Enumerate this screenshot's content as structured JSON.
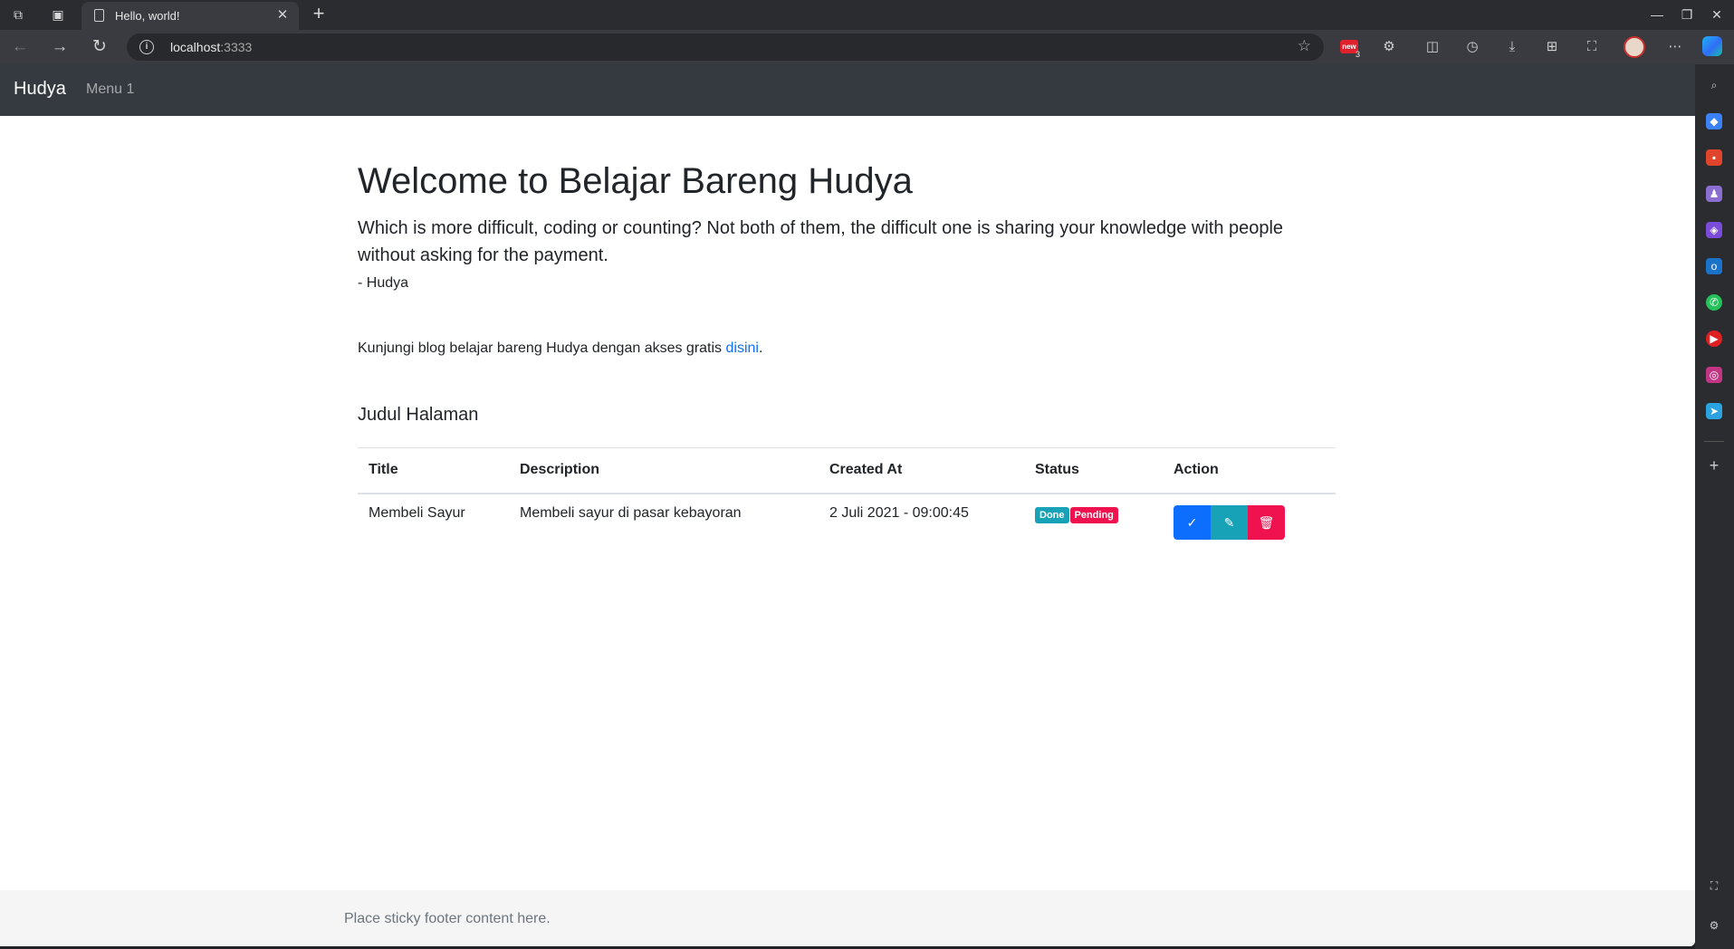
{
  "browser": {
    "tab_title": "Hello, world!",
    "url_host": "localhost",
    "url_port": ":3333",
    "extension_badge": "new",
    "extension_count": "3"
  },
  "navbar": {
    "brand": "Hudya",
    "menu_item": "Menu 1"
  },
  "hero": {
    "title": "Welcome to Belajar Bareng Hudya",
    "lead": "Which is more difficult, coding or counting? Not both of them, the difficult one is sharing your knowledge with people without asking for the payment.",
    "author": "- Hudya"
  },
  "blog": {
    "text_before": "Kunjungi blog belajar bareng Hudya dengan akses gratis ",
    "link_text": "disini",
    "text_after": "."
  },
  "page_title": "Judul Halaman",
  "table": {
    "headers": [
      "Title",
      "Description",
      "Created At",
      "Status",
      "Action"
    ],
    "rows": [
      {
        "title": "Membeli Sayur",
        "description": "Membeli sayur di pasar kebayoran",
        "created_at": "2 Juli 2021 - 09:00:45",
        "status_badges": [
          "Done",
          "Pending"
        ],
        "actions": [
          "check-icon",
          "pencil-icon",
          "trash-icon"
        ]
      }
    ]
  },
  "footer": {
    "text": "Place sticky footer content here."
  },
  "colors": {
    "navbar_bg": "#343a40",
    "primary": "#0d6efd",
    "info": "#17a2b8",
    "danger": "#f0124f",
    "footer_bg": "#f5f5f5"
  }
}
